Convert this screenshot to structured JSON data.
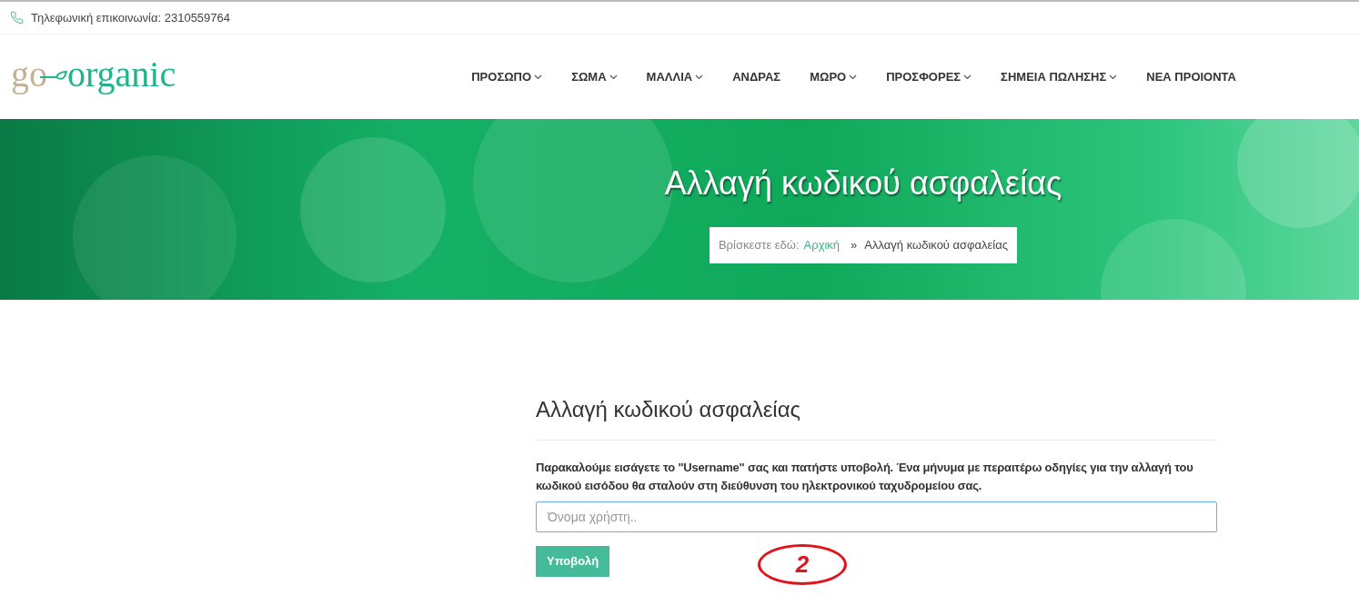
{
  "top_bar": {
    "contact": "Τηλεφωνική επικοινωνία: 2310559764"
  },
  "logo": {
    "part_1": "go",
    "part_2": "organic"
  },
  "nav": [
    {
      "label": "ΠΡΟΣΩΠΟ",
      "has_dropdown": true
    },
    {
      "label": "ΣΩΜΑ",
      "has_dropdown": true
    },
    {
      "label": "ΜΑΛΛΙΑ",
      "has_dropdown": true
    },
    {
      "label": "ΑΝΔΡΑΣ",
      "has_dropdown": false
    },
    {
      "label": "ΜΩΡΟ",
      "has_dropdown": true
    },
    {
      "label": "ΠΡΟΣΦΟΡΕΣ",
      "has_dropdown": true
    },
    {
      "label": "ΣΗΜΕΙΑ ΠΩΛΗΣΗΣ",
      "has_dropdown": true
    },
    {
      "label": "ΝΕΑ ΠΡΟΙΟΝΤΑ",
      "has_dropdown": false
    }
  ],
  "banner": {
    "title": "Αλλαγή κωδικού ασφαλείας",
    "breadcrumb": {
      "prefix": "Βρίσκεστε εδώ:",
      "home": "Αρχική",
      "separator": "»",
      "current": "Αλλαγή κωδικού ασφαλείας"
    }
  },
  "form": {
    "heading": "Αλλαγή κωδικού ασφαλείας",
    "instructions": "Παρακαλούμε εισάγετε το \"Username\" σας και πατήστε υποβολή. Ένα μήνυμα με περαιτέρω οδηγίες για την αλλαγή του κωδικού εισόδου θα σταλούν στη διεύθυνση του ηλεκτρονικού ταχυδρομείου σας.",
    "username": {
      "placeholder": "Όνομα χρήστη.."
    },
    "submit": "Υποβολή"
  },
  "annotation": {
    "label": "2"
  }
}
